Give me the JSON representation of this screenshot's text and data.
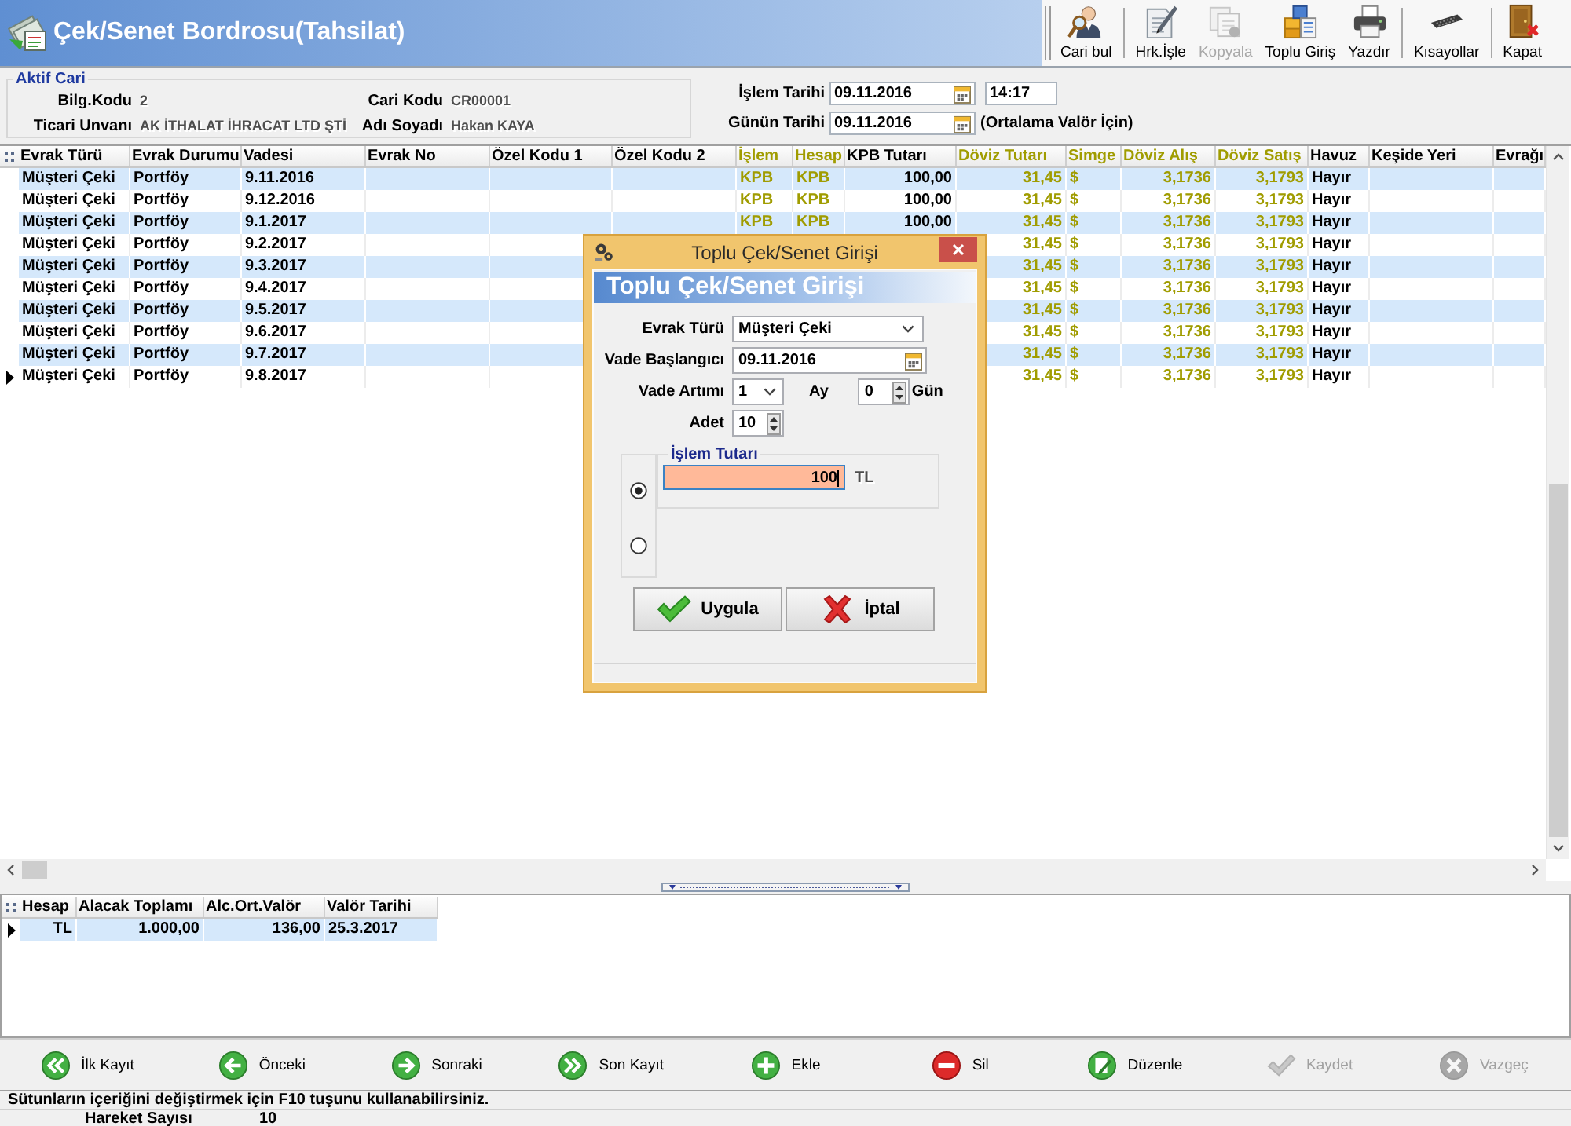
{
  "window": {
    "title": "Çek/Senet Bordrosu(Tahsilat)"
  },
  "toolbar": {
    "groups": [
      [
        {
          "label": "Cari bul",
          "disabled": false
        }
      ],
      [
        {
          "label": "Hrk.İşle",
          "disabled": false
        },
        {
          "label": "Kopyala",
          "disabled": true
        },
        {
          "label": "Toplu Giriş",
          "disabled": false
        },
        {
          "label": "Yazdır",
          "disabled": false
        }
      ],
      [
        {
          "label": "Kısayollar",
          "disabled": false
        }
      ],
      [
        {
          "label": "Kapat",
          "disabled": false
        }
      ]
    ]
  },
  "aktif_cari": {
    "title": "Aktif Cari",
    "fields": [
      {
        "label": "Bilg.Kodu",
        "value": "2"
      },
      {
        "label": "Cari Kodu",
        "value": "CR00001"
      },
      {
        "label": "Ticari Unvanı",
        "value": "AK İTHALAT İHRACAT LTD ŞTİ"
      },
      {
        "label": "Adı Soyadı",
        "value": "Hakan KAYA"
      }
    ]
  },
  "dates": [
    {
      "label": "İşlem Tarihi",
      "date": "09.11.2016",
      "time": "14:17"
    },
    {
      "label": "Günün Tarihi",
      "date": "09.11.2016",
      "note": "(Ortalama Valör İçin)"
    }
  ],
  "grid": {
    "columns": [
      {
        "label": "Evrak Türü",
        "color": "#000000"
      },
      {
        "label": "Evrak Durumu",
        "color": "#000000"
      },
      {
        "label": "Vadesi",
        "color": "#000000"
      },
      {
        "label": "Evrak No",
        "color": "#000000"
      },
      {
        "label": "Özel Kodu 1",
        "color": "#000000"
      },
      {
        "label": "Özel Kodu 2",
        "color": "#000000"
      },
      {
        "label": "İşlem",
        "color": "#a09c00"
      },
      {
        "label": "Hesap",
        "color": "#a09c00"
      },
      {
        "label": "KPB Tutarı",
        "color": "#000000"
      },
      {
        "label": "Döviz Tutarı",
        "color": "#a09c00"
      },
      {
        "label": "Simge",
        "color": "#a09c00"
      },
      {
        "label": "Döviz Alış",
        "color": "#a09c00"
      },
      {
        "label": "Döviz Satış",
        "color": "#a09c00"
      },
      {
        "label": "Havuz",
        "color": "#000000"
      },
      {
        "label": "Keşide Yeri",
        "color": "#000000"
      },
      {
        "label": "Evrağı",
        "color": "#000000"
      }
    ],
    "rows": [
      {
        "current": false,
        "evrak_turu": "Müşteri Çeki",
        "evrak_durumu": "Portföy",
        "vadesi": "9.11.2016",
        "islem": "KPB",
        "hesap": "KPB",
        "kpb_tutari": "100,00",
        "doviz_tutari": "31,45",
        "simge": "$",
        "doviz_alis": "3,1736",
        "doviz_satis": "3,1793",
        "havuz": "Hayır"
      },
      {
        "current": false,
        "evrak_turu": "Müşteri Çeki",
        "evrak_durumu": "Portföy",
        "vadesi": "9.12.2016",
        "islem": "KPB",
        "hesap": "KPB",
        "kpb_tutari": "100,00",
        "doviz_tutari": "31,45",
        "simge": "$",
        "doviz_alis": "3,1736",
        "doviz_satis": "3,1793",
        "havuz": "Hayır"
      },
      {
        "current": false,
        "evrak_turu": "Müşteri Çeki",
        "evrak_durumu": "Portföy",
        "vadesi": "9.1.2017",
        "islem": "KPB",
        "hesap": "KPB",
        "kpb_tutari": "100,00",
        "doviz_tutari": "31,45",
        "simge": "$",
        "doviz_alis": "3,1736",
        "doviz_satis": "3,1793",
        "havuz": "Hayır"
      },
      {
        "current": false,
        "evrak_turu": "Müşteri Çeki",
        "evrak_durumu": "Portföy",
        "vadesi": "9.2.2017",
        "doviz_tutari": "31,45",
        "simge": "$",
        "doviz_alis": "3,1736",
        "doviz_satis": "3,1793",
        "havuz": "Hayır"
      },
      {
        "current": false,
        "evrak_turu": "Müşteri Çeki",
        "evrak_durumu": "Portföy",
        "vadesi": "9.3.2017",
        "doviz_tutari": "31,45",
        "simge": "$",
        "doviz_alis": "3,1736",
        "doviz_satis": "3,1793",
        "havuz": "Hayır"
      },
      {
        "current": false,
        "evrak_turu": "Müşteri Çeki",
        "evrak_durumu": "Portföy",
        "vadesi": "9.4.2017",
        "doviz_tutari": "31,45",
        "simge": "$",
        "doviz_alis": "3,1736",
        "doviz_satis": "3,1793",
        "havuz": "Hayır"
      },
      {
        "current": false,
        "evrak_turu": "Müşteri Çeki",
        "evrak_durumu": "Portföy",
        "vadesi": "9.5.2017",
        "doviz_tutari": "31,45",
        "simge": "$",
        "doviz_alis": "3,1736",
        "doviz_satis": "3,1793",
        "havuz": "Hayır"
      },
      {
        "current": false,
        "evrak_turu": "Müşteri Çeki",
        "evrak_durumu": "Portföy",
        "vadesi": "9.6.2017",
        "doviz_tutari": "31,45",
        "simge": "$",
        "doviz_alis": "3,1736",
        "doviz_satis": "3,1793",
        "havuz": "Hayır"
      },
      {
        "current": false,
        "evrak_turu": "Müşteri Çeki",
        "evrak_durumu": "Portföy",
        "vadesi": "9.7.2017",
        "doviz_tutari": "31,45",
        "simge": "$",
        "doviz_alis": "3,1736",
        "doviz_satis": "3,1793",
        "havuz": "Hayır"
      },
      {
        "current": true,
        "evrak_turu": "Müşteri Çeki",
        "evrak_durumu": "Portföy",
        "vadesi": "9.8.2017",
        "doviz_tutari": "31,45",
        "simge": "$",
        "doviz_alis": "3,1736",
        "doviz_satis": "3,1793",
        "havuz": "Hayır"
      }
    ]
  },
  "summary_table": {
    "columns": [
      {
        "label": "Hesap"
      },
      {
        "label": "Alacak Toplamı"
      },
      {
        "label": "Alc.Ort.Valör"
      },
      {
        "label": "Valör Tarihi"
      }
    ],
    "rows": [
      {
        "current": true,
        "hesap": "TL",
        "alacak_toplami": "1.000,00",
        "alc_ort_valor": "136,00",
        "valor_tarihi": "25.3.2017"
      }
    ]
  },
  "nav_buttons": [
    {
      "label": "İlk Kayıt",
      "disabled": false
    },
    {
      "label": "Önceki",
      "disabled": false
    },
    {
      "label": "Sonraki",
      "disabled": false
    },
    {
      "label": "Son Kayıt",
      "disabled": false
    },
    {
      "label": "Ekle",
      "disabled": false
    },
    {
      "label": "Sil",
      "disabled": false
    },
    {
      "label": "Düzenle",
      "disabled": false
    },
    {
      "label": "Kaydet",
      "disabled": true
    },
    {
      "label": "Vazgeç",
      "disabled": true
    }
  ],
  "status_bar": {
    "hint": "Sütunların içeriğini değiştirmek için F10 tuşunu kullanabilirsiniz.",
    "count_label": "Hareket Sayısı",
    "count": "10"
  },
  "dialog": {
    "title": "Toplu Çek/Senet Girişi",
    "heading": "Toplu Çek/Senet Girişi",
    "evrak_turu": {
      "label": "Evrak Türü",
      "value": "Müşteri Çeki"
    },
    "vade_baslangici": {
      "label": "Vade Başlangıcı",
      "value": "09.11.2016"
    },
    "vade_artimi": {
      "label": "Vade Artımı",
      "value": "1",
      "unit": "Ay"
    },
    "gun": {
      "value": "0",
      "unit": "Gün"
    },
    "adet": {
      "label": "Adet",
      "value": "10"
    },
    "radio_options": [
      {
        "selected": true
      },
      {
        "selected": false
      }
    ],
    "amount": {
      "title": "İşlem Tutarı",
      "value": "100",
      "currency": "TL",
      "focused": true
    },
    "buttons": [
      {
        "label": "Uygula"
      },
      {
        "label": "İptal"
      }
    ]
  }
}
